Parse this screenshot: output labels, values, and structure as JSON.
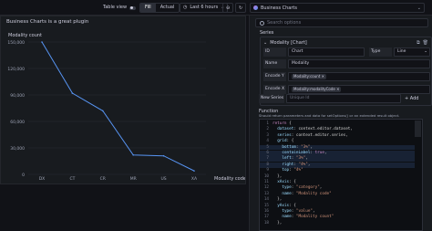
{
  "toolbar": {
    "table_view_label": "Table view",
    "fill_label": "Fill",
    "actual_label": "Actual",
    "time_range_label": "Last 6 hours",
    "viz_label": "Business Charts"
  },
  "panel": {
    "title": "Business Charts is a great plugin"
  },
  "chart_data": {
    "type": "line",
    "title": "Business Charts is a great plugin",
    "ylabel": "Modality count",
    "xlabel": "Modality code",
    "categories": [
      "DX",
      "CT",
      "CR",
      "MR",
      "US",
      "XA"
    ],
    "values": [
      150000,
      92000,
      72000,
      22000,
      21000,
      4000
    ],
    "yticks": [
      "0",
      "30,000",
      "60,000",
      "90,000",
      "120,000",
      "150,000"
    ],
    "ylim": [
      0,
      150000
    ],
    "grid": true,
    "line_color": "#5794f2"
  },
  "options": {
    "search_placeholder": "Search options",
    "series_section": "Series",
    "series_title": "Modality [Chart]",
    "fields": [
      {
        "label": "ID",
        "value": "Chart"
      },
      {
        "label": "Name",
        "value": "Modality"
      },
      {
        "label": "Encode Y",
        "value": "Modality:count"
      },
      {
        "label": "Encode X",
        "value": "Modality:modalityCode"
      }
    ],
    "type_label": "Type",
    "type_value": "Line",
    "new_series_label": "New Series",
    "new_series_placeholder": "Unique Id",
    "add_label": "Add",
    "function_section": "Function",
    "function_desc": "Should return parameters and data for setOptions() or an extended result object.",
    "code_lines": [
      "return {",
      "  dataset: context.editor.dataset,",
      "  series: context.editor.series,",
      "  grid: {",
      "    bottom: \"3%\",",
      "    containLabel: true,",
      "    left: \"3%\",",
      "    right: \"4%\",",
      "    top: \"4%\"",
      "  },",
      "  xAxis: {",
      "    type: \"category\",",
      "    name: \"Modality code\"",
      "  },",
      "  yAxis: {",
      "    type: \"value\",",
      "    name: \"Modality count\"",
      "  },"
    ]
  }
}
